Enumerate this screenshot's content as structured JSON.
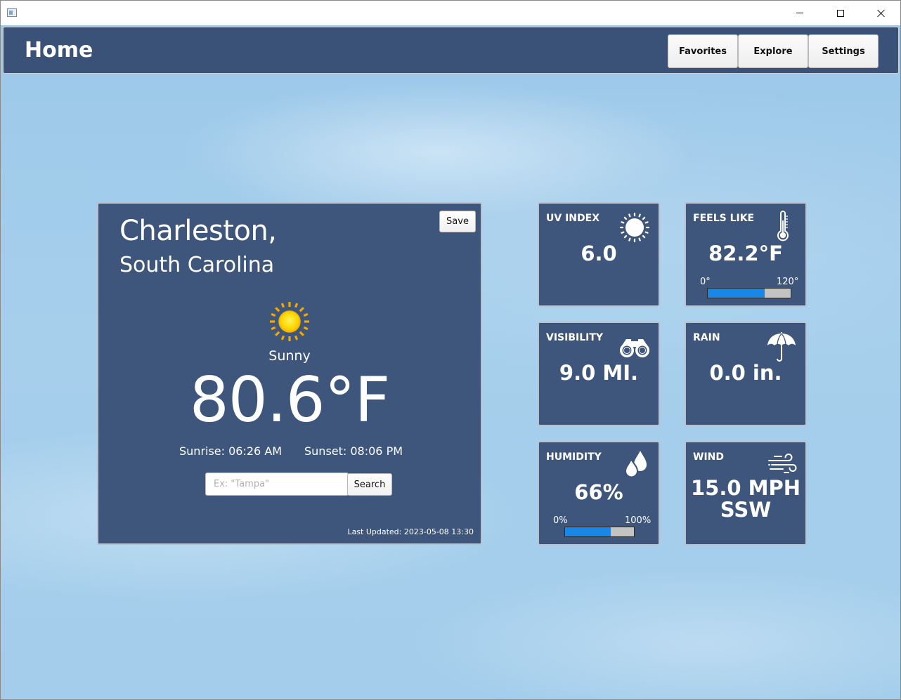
{
  "window": {
    "minimize": "minimize",
    "maximize": "maximize",
    "close": "close"
  },
  "header": {
    "title": "Home",
    "nav": {
      "favorites": "Favorites",
      "explore": "Explore",
      "settings": "Settings"
    }
  },
  "main": {
    "city": "Charleston,",
    "state": "South Carolina",
    "save_label": "Save",
    "condition_icon": "sun-icon",
    "condition": "Sunny",
    "temperature": "80.6°F",
    "sunrise": "Sunrise: 06:26 AM",
    "sunset": "Sunset: 08:06 PM",
    "search_placeholder": "Ex: \"Tampa\"",
    "search_value": "",
    "search_label": "Search",
    "last_updated": "Last Updated: 2023-05-08 13:30"
  },
  "tiles": {
    "uv": {
      "label": "UV INDEX",
      "value": "6.0",
      "icon": "sun-outline-icon"
    },
    "feels_like": {
      "label": "FEELS LIKE",
      "value": "82.2°F",
      "icon": "thermometer-icon",
      "range_min": "0°",
      "range_max": "120°",
      "fill_fraction": 0.685
    },
    "visibility": {
      "label": "VISIBILITY",
      "value": "9.0 MI.",
      "icon": "binoculars-icon"
    },
    "rain": {
      "label": "RAIN",
      "value": "0.0 in.",
      "icon": "umbrella-icon"
    },
    "humidity": {
      "label": "HUMIDITY",
      "value": "66%",
      "icon": "water-drops-icon",
      "range_min": "0%",
      "range_max": "100%",
      "fill_fraction": 0.66
    },
    "wind": {
      "label": "WIND",
      "speed": "15.0 MPH",
      "direction": "SSW",
      "icon": "wind-icon"
    }
  },
  "colors": {
    "panel": "#3b5278",
    "sky": "#a3cdeb",
    "bar_fill": "#1a86e6",
    "bar_empty": "#c3c3c3",
    "sun_yellow": "#ffd500",
    "sun_orange": "#f5a800"
  }
}
